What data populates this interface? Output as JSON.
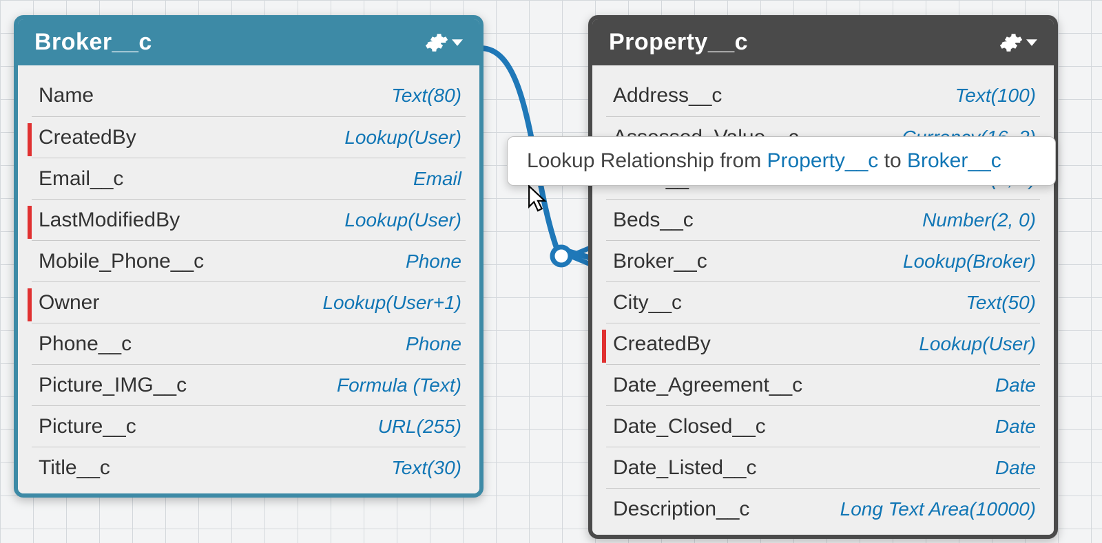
{
  "tooltip": {
    "prefix": "Lookup Relationship from ",
    "from": "Property__c",
    "middle": " to ",
    "to": "Broker__c"
  },
  "panels": {
    "broker": {
      "title": "Broker__c",
      "fields": [
        {
          "name": "Name",
          "type": "Text(80)",
          "marked": false
        },
        {
          "name": "CreatedBy",
          "type": "Lookup(User)",
          "marked": true
        },
        {
          "name": "Email__c",
          "type": "Email",
          "marked": false
        },
        {
          "name": "LastModifiedBy",
          "type": "Lookup(User)",
          "marked": true
        },
        {
          "name": "Mobile_Phone__c",
          "type": "Phone",
          "marked": false
        },
        {
          "name": "Owner",
          "type": "Lookup(User+1)",
          "marked": true
        },
        {
          "name": "Phone__c",
          "type": "Phone",
          "marked": false
        },
        {
          "name": "Picture_IMG__c",
          "type": "Formula (Text)",
          "marked": false
        },
        {
          "name": "Picture__c",
          "type": "URL(255)",
          "marked": false
        },
        {
          "name": "Title__c",
          "type": "Text(30)",
          "marked": false
        }
      ]
    },
    "property": {
      "title": "Property__c",
      "fields": [
        {
          "name": "Address__c",
          "type": "Text(100)",
          "marked": false
        },
        {
          "name": "Assessed_Value__c",
          "type": "Currency(16, 2)",
          "marked": false
        },
        {
          "name": "Baths__c",
          "type": "Number(2, 0)",
          "marked": false
        },
        {
          "name": "Beds__c",
          "type": "Number(2, 0)",
          "marked": false
        },
        {
          "name": "Broker__c",
          "type": "Lookup(Broker)",
          "marked": false
        },
        {
          "name": "City__c",
          "type": "Text(50)",
          "marked": false
        },
        {
          "name": "CreatedBy",
          "type": "Lookup(User)",
          "marked": true
        },
        {
          "name": "Date_Agreement__c",
          "type": "Date",
          "marked": false
        },
        {
          "name": "Date_Closed__c",
          "type": "Date",
          "marked": false
        },
        {
          "name": "Date_Listed__c",
          "type": "Date",
          "marked": false
        },
        {
          "name": "Description__c",
          "type": "Long Text Area(10000)",
          "marked": false
        }
      ]
    }
  }
}
